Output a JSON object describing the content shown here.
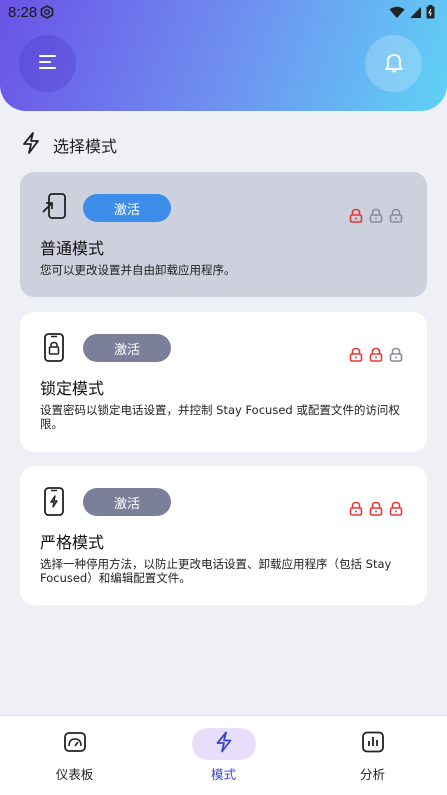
{
  "status_bar": {
    "time": "8:28"
  },
  "header": {},
  "section": {
    "title": "选择模式"
  },
  "modes": [
    {
      "title": "普通模式",
      "description": "您可以更改设置并自由卸载应用程序。",
      "button": "激活",
      "active": true,
      "locks": [
        "red",
        "gray",
        "gray"
      ]
    },
    {
      "title": "锁定模式",
      "description": "设置密码以锁定电话设置，并控制 Stay Focused 或配置文件的访问权限。",
      "button": "激活",
      "active": false,
      "locks": [
        "red",
        "red",
        "gray"
      ]
    },
    {
      "title": "严格模式",
      "description": "选择一种停用方法，以防止更改电话设置、卸载应用程序（包括 Stay Focused）和编辑配置文件。",
      "button": "激活",
      "active": false,
      "locks": [
        "red",
        "red",
        "red"
      ]
    }
  ],
  "bottom_nav": [
    {
      "label": "仪表板",
      "icon": "dashboard-gauge-icon",
      "active": false
    },
    {
      "label": "模式",
      "icon": "lightning-icon",
      "active": true
    },
    {
      "label": "分析",
      "icon": "bar-chart-icon",
      "active": false
    }
  ],
  "colors": {
    "lock_red": "#e53935",
    "lock_gray": "#8a8d99",
    "accent": "#3d8ee8",
    "nav_active": "#3a46c7"
  }
}
